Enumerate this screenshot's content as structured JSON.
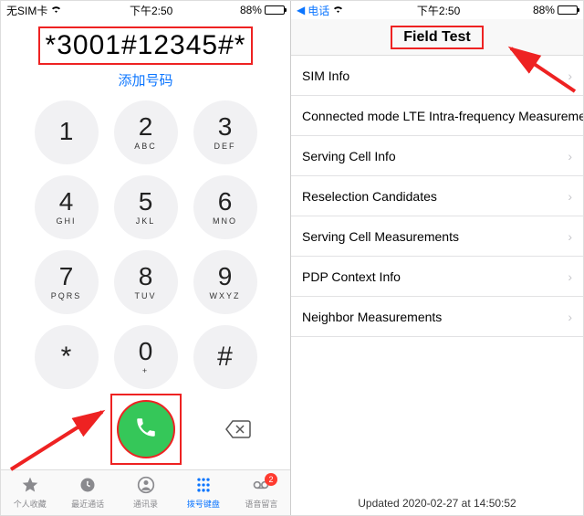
{
  "left": {
    "status": {
      "carrier": "无SIM卡",
      "time": "下午2:50",
      "battery": "88%"
    },
    "dial_number": "*3001#12345#*",
    "add_number_label": "添加号码",
    "keys": [
      {
        "digit": "1",
        "letters": ""
      },
      {
        "digit": "2",
        "letters": "ABC"
      },
      {
        "digit": "3",
        "letters": "DEF"
      },
      {
        "digit": "4",
        "letters": "GHI"
      },
      {
        "digit": "5",
        "letters": "JKL"
      },
      {
        "digit": "6",
        "letters": "MNO"
      },
      {
        "digit": "7",
        "letters": "PQRS"
      },
      {
        "digit": "8",
        "letters": "TUV"
      },
      {
        "digit": "9",
        "letters": "WXYZ"
      },
      {
        "digit": "*",
        "letters": ""
      },
      {
        "digit": "0",
        "letters": "+"
      },
      {
        "digit": "#",
        "letters": ""
      }
    ],
    "tabs": {
      "favorites": "个人收藏",
      "recents": "最近通话",
      "contacts": "通讯录",
      "keypad": "拨号键盘",
      "voicemail": "语音留言",
      "voicemail_badge": "2"
    }
  },
  "right": {
    "status": {
      "back": "电话",
      "time": "下午2:50",
      "battery": "88%"
    },
    "title": "Field Test",
    "items": [
      "SIM Info",
      "Connected mode LTE Intra-frequency Measuremen",
      "Serving Cell Info",
      "Reselection Candidates",
      "Serving Cell Measurements",
      "PDP Context Info",
      "Neighbor Measurements"
    ],
    "footer": "Updated 2020-02-27 at 14:50:52"
  }
}
